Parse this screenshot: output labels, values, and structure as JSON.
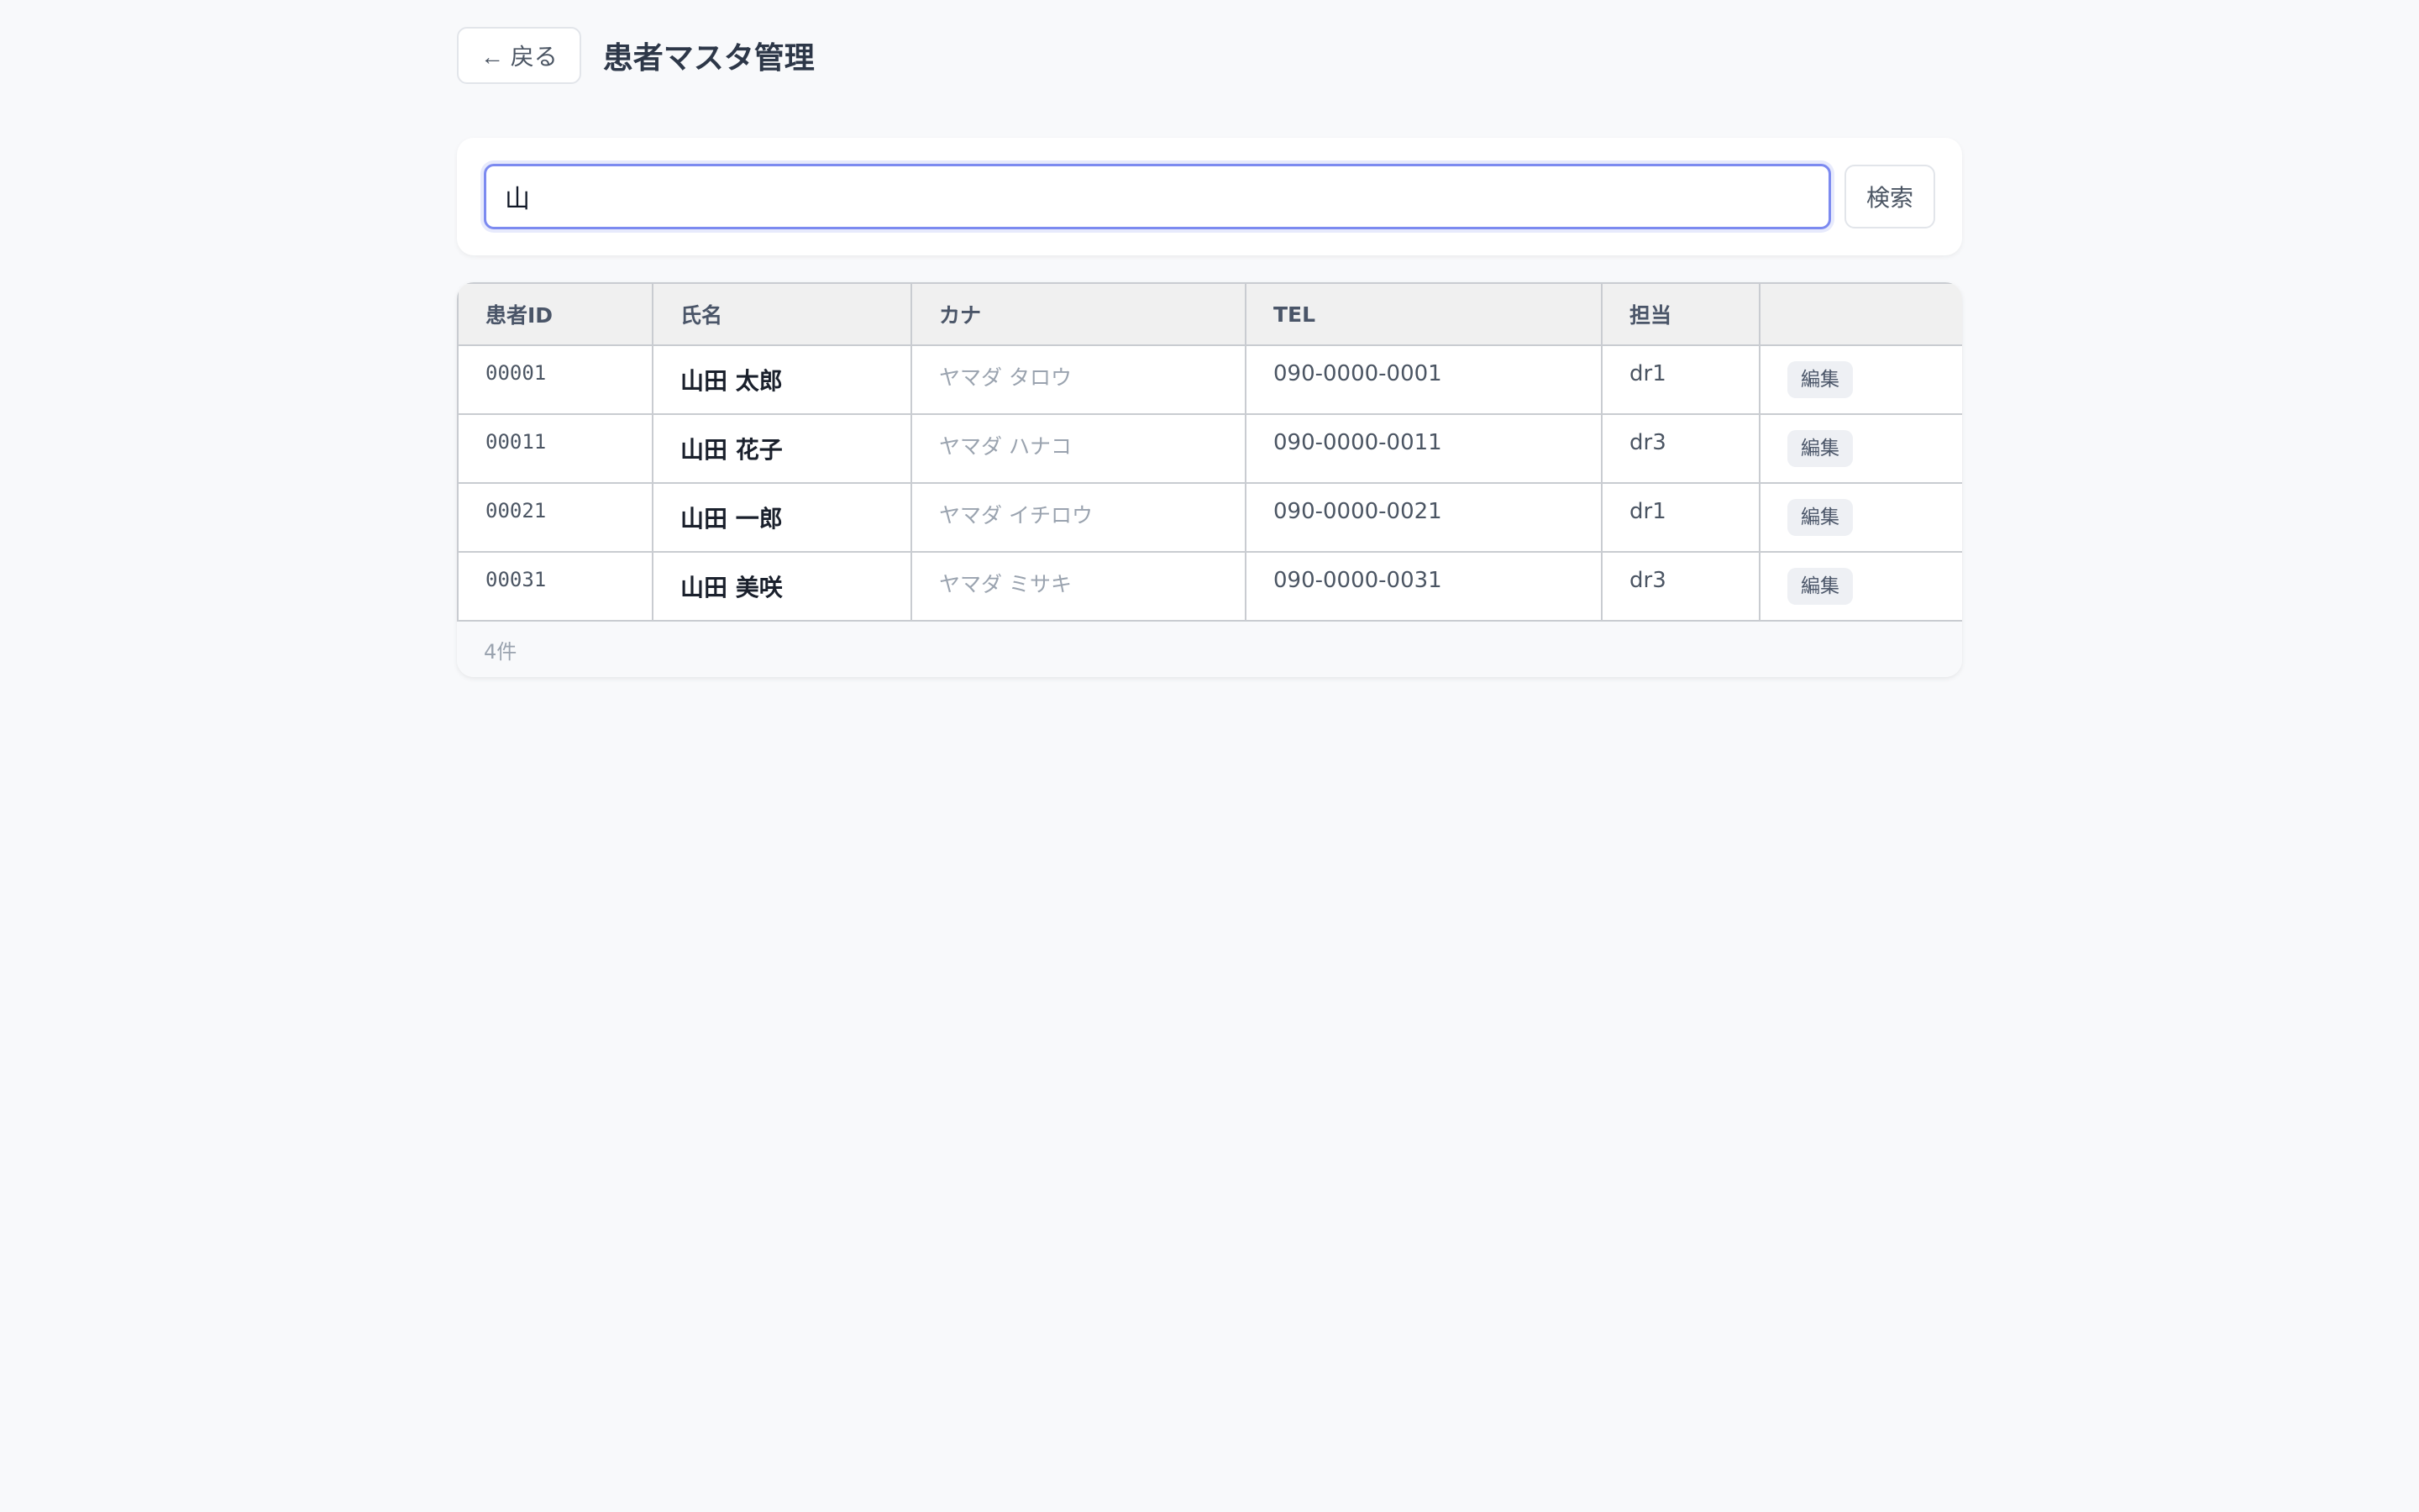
{
  "header": {
    "back_label": "← 戻る",
    "title": "患者マスタ管理"
  },
  "search": {
    "value": "山",
    "button_label": "検索"
  },
  "table": {
    "columns": [
      "患者ID",
      "氏名",
      "カナ",
      "TEL",
      "担当",
      ""
    ],
    "rows": [
      {
        "id": "00001",
        "name": "山田 太郎",
        "kana": "ヤマダ タロウ",
        "tel": "090-0000-0001",
        "staff": "dr1",
        "action": "編集"
      },
      {
        "id": "00011",
        "name": "山田 花子",
        "kana": "ヤマダ ハナコ",
        "tel": "090-0000-0011",
        "staff": "dr3",
        "action": "編集"
      },
      {
        "id": "00021",
        "name": "山田 一郎",
        "kana": "ヤマダ イチロウ",
        "tel": "090-0000-0021",
        "staff": "dr1",
        "action": "編集"
      },
      {
        "id": "00031",
        "name": "山田 美咲",
        "kana": "ヤマダ ミサキ",
        "tel": "090-0000-0031",
        "staff": "dr3",
        "action": "編集"
      }
    ],
    "count_label": "4件"
  },
  "colors": {
    "accent": "#7c8af0",
    "background": "#f8f9fb"
  }
}
